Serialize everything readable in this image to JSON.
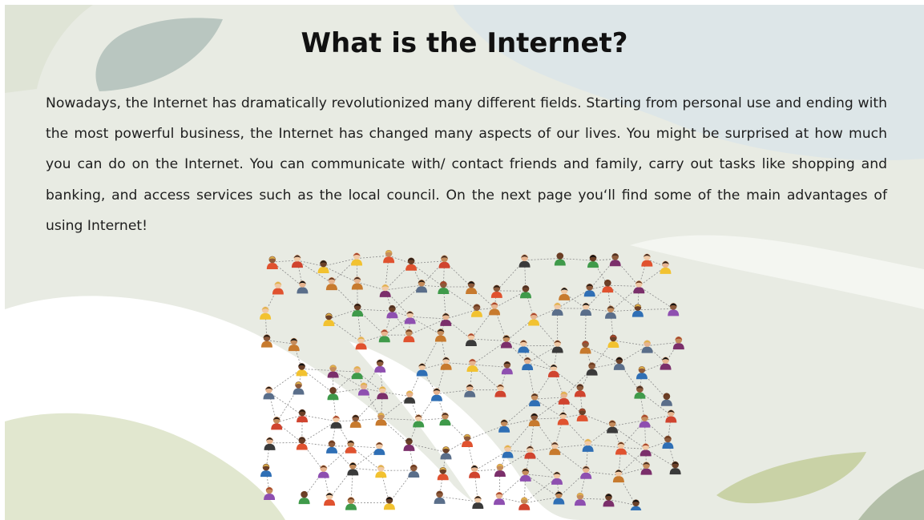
{
  "slide": {
    "title": "What is the Internet?",
    "body": "Nowadays, the Internet has dramatically revolutionized many different fields. Starting from personal use and ending with the most powerful business, the Internet has changed many aspects of our lives. You might be surprised at how much you can do on the Internet. You can communicate with/ contact friends and family, carry out tasks like shopping and banking, and access services such as the local council. On the next page you‘ll find some of the main advantages of using Internet!",
    "illustration_icon": "people-network-icon"
  },
  "colors": {
    "background": "#e8ebe3",
    "light_blue_shape": "#dde6e8",
    "sage_leaf": "#b9c6c0",
    "olive_leaf": "#c9d2a6",
    "white_wave": "#ffffff",
    "text": "#1e1e1e"
  }
}
